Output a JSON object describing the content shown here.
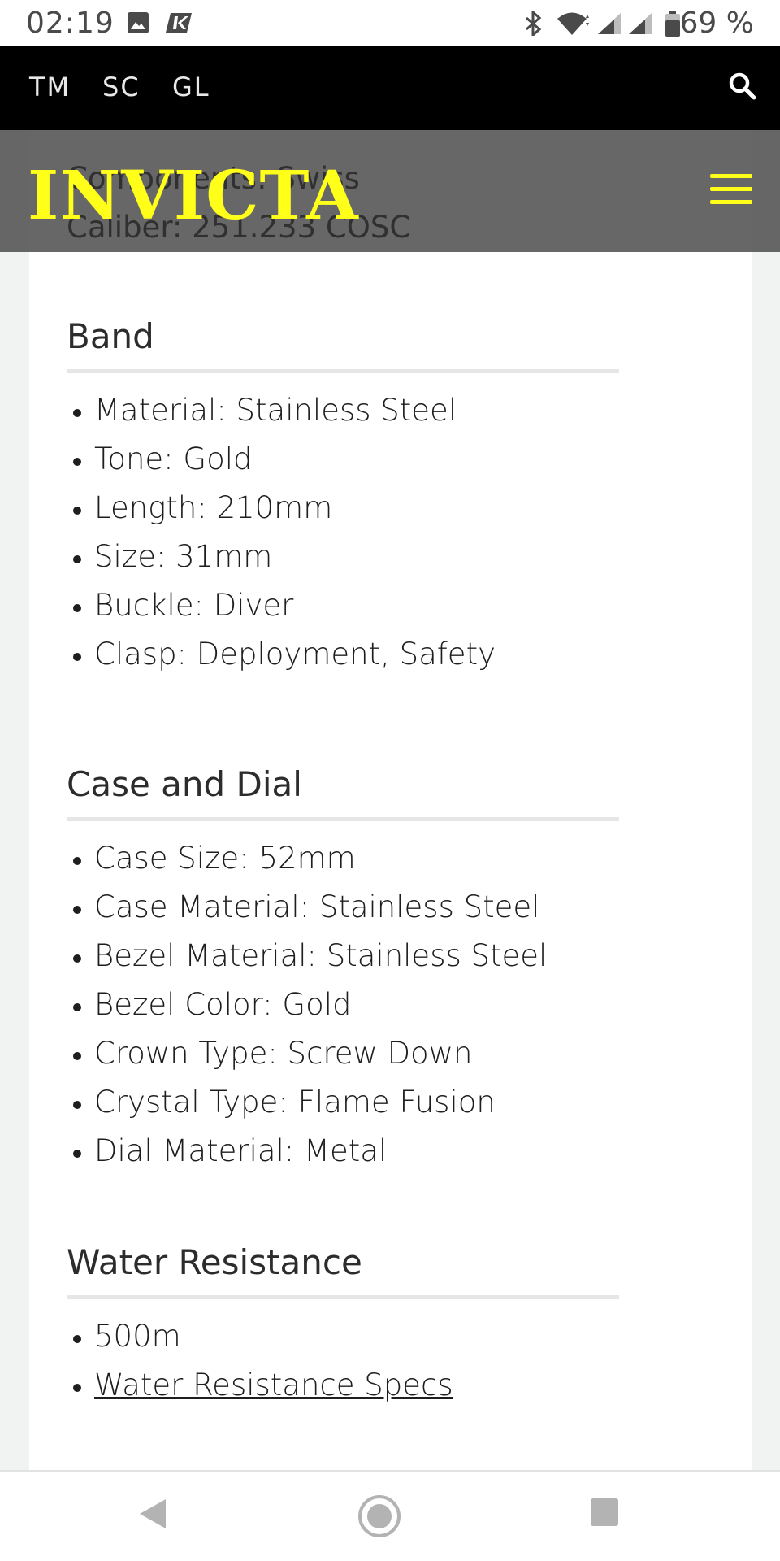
{
  "status_bar": {
    "time": "02:19",
    "battery_percent": "69 %",
    "icons": [
      "image-icon",
      "app-k-icon",
      "bluetooth-icon",
      "wifi-icon",
      "signal-icon",
      "signal-icon",
      "battery-icon"
    ]
  },
  "top_nav": {
    "links": [
      "TM",
      "SC",
      "GL"
    ],
    "search_icon": "search-icon"
  },
  "brand_bar": {
    "logo": "INVICTA",
    "behind_text": [
      "Components: Swiss",
      "Caliber: 251.233 COSC"
    ],
    "menu_icon": "hamburger-icon",
    "accent_color": "#ffff1a"
  },
  "sections": {
    "band": {
      "title": "Band",
      "items": [
        "Material: Stainless Steel",
        "Tone: Gold",
        "Length: 210mm",
        "Size: 31mm",
        "Buckle: Diver",
        "Clasp: Deployment, Safety"
      ]
    },
    "case_dial": {
      "title": "Case and Dial",
      "items": [
        "Case Size: 52mm",
        "Case Material: Stainless Steel",
        "Bezel Material: Stainless Steel",
        "Bezel Color: Gold",
        "Crown Type: Screw Down",
        "Crystal Type: Flame Fusion",
        "Dial Material: Metal"
      ]
    },
    "water": {
      "title": "Water Resistance",
      "items": [
        "500m"
      ],
      "link": "Water Resistance Specs"
    }
  },
  "bottom_nav": {
    "icons": [
      "back-icon",
      "home-icon",
      "recents-icon"
    ]
  }
}
